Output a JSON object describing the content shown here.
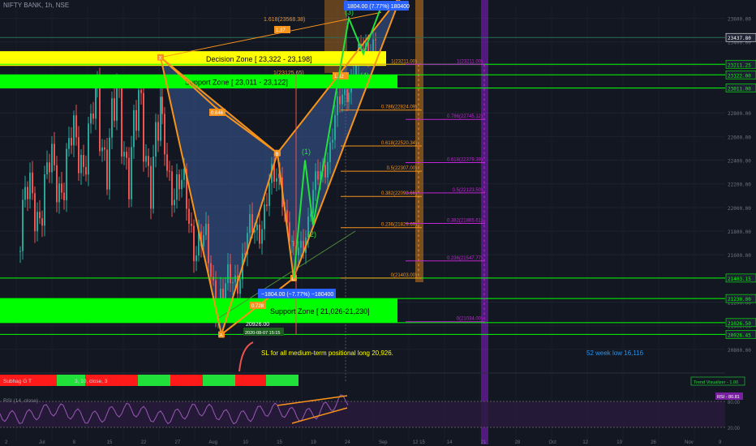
{
  "header": {
    "symbol": "NIFTY BANK, 1h, NSE"
  },
  "colors": {
    "bg": "#131722",
    "bull": "#26a69a",
    "bear": "#ef5350",
    "pattern": "#f7931a",
    "wave": "#22e03a",
    "zone_yellow": "#ffff00",
    "zone_green": "#00ff00",
    "fib_orange": "#f7931a",
    "fib_purple": "#c026d3",
    "rsi": "#9b59b6"
  },
  "chart_data": {
    "type": "candlestick",
    "ylim": [
      20600,
      23700
    ],
    "y_ticks": [
      {
        "value": 23600,
        "label": "23600.00"
      },
      {
        "value": 23400,
        "label": "23400.00"
      },
      {
        "value": 23200,
        "label": "23200.00"
      },
      {
        "value": 23000,
        "label": "23000.00"
      },
      {
        "value": 22800,
        "label": "22800.00"
      },
      {
        "value": 22600,
        "label": "22600.00"
      },
      {
        "value": 22400,
        "label": "22400.00"
      },
      {
        "value": 22200,
        "label": "22200.00"
      },
      {
        "value": 22000,
        "label": "22000.00"
      },
      {
        "value": 21800,
        "label": "21800.00"
      },
      {
        "value": 21600,
        "label": "21600.00"
      },
      {
        "value": 21400,
        "label": "21400.00"
      },
      {
        "value": 21200,
        "label": "21200.00"
      },
      {
        "value": 21000,
        "label": "21000.00"
      },
      {
        "value": 20800,
        "label": "20800.00"
      }
    ],
    "price_labels": [
      {
        "value": 23437.8,
        "label": "23437.80",
        "color": "#ffffff"
      },
      {
        "value": 23211.25,
        "label": "23211.25",
        "color": "#00ff00"
      },
      {
        "value": 23122.0,
        "label": "23122.00",
        "color": "#00ff00"
      },
      {
        "value": 23011.0,
        "label": "23011.00",
        "color": "#00ff00"
      },
      {
        "value": 21403.15,
        "label": "21403.15",
        "color": "#00ff00"
      },
      {
        "value": 21230.0,
        "label": "21230.00",
        "color": "#00ff00"
      },
      {
        "value": 21026.5,
        "label": "21026.50",
        "color": "#00ff00"
      },
      {
        "value": 20926.45,
        "label": "20926.45",
        "color": "#00ff00"
      }
    ],
    "x_ticks": [
      "2",
      "Jul",
      "8",
      "15",
      "22",
      "27",
      "Aug",
      "10",
      "15",
      "19",
      "24",
      "Sep",
      "12 15",
      "14",
      "21",
      "28",
      "Oct",
      "12",
      "19",
      "26",
      "Nov",
      "9"
    ],
    "candles": [],
    "zones": [
      {
        "label": "Decision Zone [ 23,322 - 23,198]",
        "from": 23198,
        "to": 23322,
        "color": "#ffff00"
      },
      {
        "label": "Support Zone [ 23,011 - 23,122]",
        "from": 23011,
        "to": 23122,
        "color": "#00ff00"
      },
      {
        "label": "Support Zone [ 21,026-21,230]",
        "from": 21026,
        "to": 21230,
        "color": "#00ff00"
      }
    ],
    "harmonic": {
      "points": [
        {
          "name": "X",
          "value": 23270
        },
        {
          "name": "A",
          "value": 20926
        },
        {
          "name": "B",
          "value": 22460
        },
        {
          "name": "C",
          "value": 21403
        },
        {
          "name": "D",
          "value": 23800
        }
      ],
      "ratios": [
        "0.646",
        "0.728",
        "1.37",
        "1.32"
      ],
      "fib_note_a": "1.618(23568.38)",
      "fib_note_b": "1(23125.65)"
    },
    "wave_labels": [
      "(1)",
      "(2)",
      "(3)",
      "(4)",
      "(5)"
    ],
    "fib_orange": [
      {
        "label": "1(23211.00)",
        "value": 23211
      },
      {
        "label": "0.786(22824.09)",
        "value": 22824.09
      },
      {
        "label": "0.618(22520.34)",
        "value": 22520.34
      },
      {
        "label": "0.5(22307.00)",
        "value": 22307
      },
      {
        "label": "0.382(22093.66)",
        "value": 22093.66
      },
      {
        "label": "0.236(21829.69)",
        "value": 21829.69
      },
      {
        "label": "0(21403.00)",
        "value": 21403
      }
    ],
    "fib_purple": [
      {
        "label": "1(23211.00)",
        "value": 23211
      },
      {
        "label": "0.786(22745.12)",
        "value": 22745.12
      },
      {
        "label": "0.618(22379.39)",
        "value": 22379.39
      },
      {
        "label": "0.5(22123.50)",
        "value": 22123.5
      },
      {
        "label": "0.382(21865.61)",
        "value": 21865.61
      },
      {
        "label": "0.236(21547.77)",
        "value": 21547.77
      },
      {
        "label": "0(21034.00)",
        "value": 21034
      }
    ],
    "callouts": {
      "top": "1804.00 (7.77%) 180400",
      "mid": "−1804.00 (−7.77%) −180400",
      "low_price": "20926.00",
      "low_date": "2020-08-07 15:15"
    },
    "notes": {
      "sl": "SL for all medium-term positional long 20,926.",
      "week52": "52 week  low 16,116"
    }
  },
  "indicators": {
    "trend_label": "Subhag G T",
    "trend_params": "3, 10, close, 3",
    "trend_visualizer": "Trend Visualizer - 1.00",
    "trend_blocks": [
      {
        "color": "red",
        "width": 70
      },
      {
        "color": "green",
        "width": 35
      },
      {
        "color": "red",
        "width": 65
      },
      {
        "color": "green",
        "width": 40
      },
      {
        "color": "red",
        "width": 40
      },
      {
        "color": "green",
        "width": 40
      },
      {
        "color": "red",
        "width": 38
      },
      {
        "color": "green",
        "width": 40
      }
    ],
    "rsi_label": "RSI (14, close)",
    "rsi_value": "RSI - 80.81",
    "rsi_levels": [
      "80.00",
      "20.00"
    ]
  }
}
